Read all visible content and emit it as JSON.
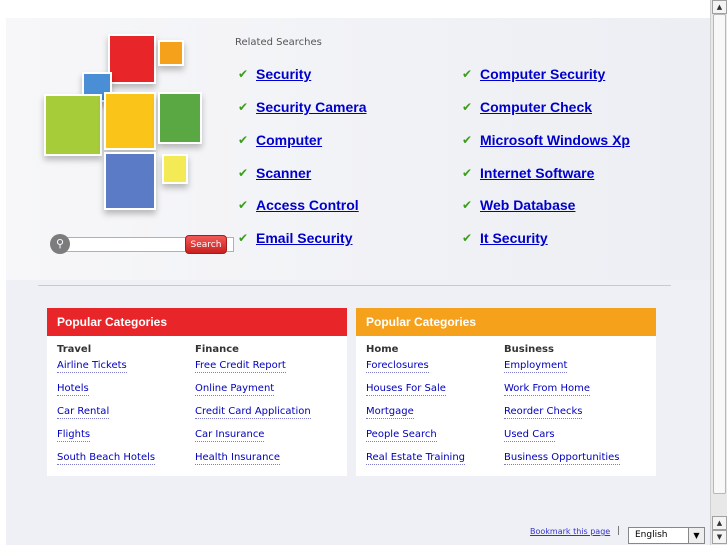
{
  "related": {
    "title": "Related Searches",
    "left": [
      "Security",
      "Security Camera",
      "Computer",
      "Scanner",
      "Access Control",
      "Email Security"
    ],
    "right": [
      "Computer Security",
      "Computer Check",
      "Microsoft Windows Xp",
      "Internet Software",
      "Web Database",
      "It Security"
    ]
  },
  "search": {
    "button_label": "Search",
    "placeholder": ""
  },
  "panels": [
    {
      "title": "Popular Categories",
      "color": "#e8262a",
      "columns": [
        {
          "heading": "Travel",
          "links": [
            "Airline Tickets",
            "Hotels",
            "Car Rental",
            "Flights",
            "South Beach Hotels"
          ]
        },
        {
          "heading": "Finance",
          "links": [
            "Free Credit Report",
            "Online Payment",
            "Credit Card Application",
            "Car Insurance",
            "Health Insurance"
          ]
        }
      ]
    },
    {
      "title": "Popular Categories",
      "color": "#f5a11b",
      "columns": [
        {
          "heading": "Home",
          "links": [
            "Foreclosures",
            "Houses For Sale",
            "Mortgage",
            "People Search",
            "Real Estate Training"
          ]
        },
        {
          "heading": "Business",
          "links": [
            "Employment",
            "Work From Home",
            "Reorder Checks",
            "Used Cars",
            "Business Opportunities"
          ]
        }
      ]
    }
  ],
  "footer": {
    "bookmark": "Bookmark this page",
    "separator": "|",
    "language": "English"
  },
  "colors": {
    "link": "#0000cc",
    "check": "#3a9e1b"
  }
}
